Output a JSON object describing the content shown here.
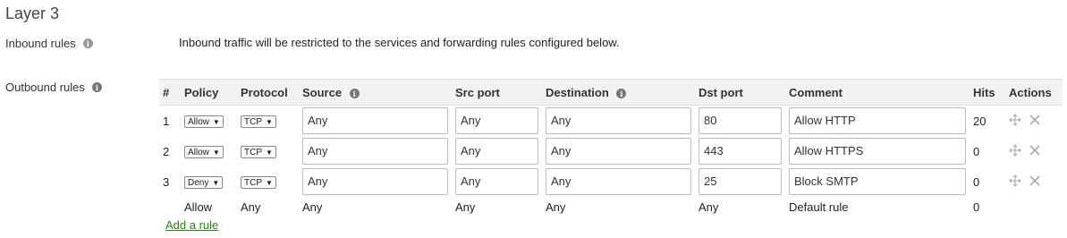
{
  "section_title": "Layer 3",
  "inbound": {
    "label": "Inbound rules",
    "info_icon": "info-icon",
    "text": "Inbound traffic will be restricted to the services and forwarding rules configured below."
  },
  "outbound": {
    "label": "Outbound rules",
    "info_icon": "info-icon",
    "headers": {
      "num": "#",
      "policy": "Policy",
      "protocol": "Protocol",
      "source": "Source",
      "src_port": "Src port",
      "destination": "Destination",
      "dst_port": "Dst port",
      "comment": "Comment",
      "hits": "Hits",
      "actions": "Actions"
    },
    "rules": [
      {
        "num": "1",
        "policy": "Allow",
        "protocol": "TCP",
        "source": "Any",
        "src_port": "Any",
        "destination": "Any",
        "dst_port": "80",
        "comment": "Allow HTTP",
        "hits": "20"
      },
      {
        "num": "2",
        "policy": "Allow",
        "protocol": "TCP",
        "source": "Any",
        "src_port": "Any",
        "destination": "Any",
        "dst_port": "443",
        "comment": "Allow HTTPS",
        "hits": "0"
      },
      {
        "num": "3",
        "policy": "Deny",
        "protocol": "TCP",
        "source": "Any",
        "src_port": "Any",
        "destination": "Any",
        "dst_port": "25",
        "comment": "Block SMTP",
        "hits": "0"
      }
    ],
    "default_rule": {
      "policy": "Allow",
      "protocol": "Any",
      "source": "Any",
      "src_port": "Any",
      "destination": "Any",
      "dst_port": "Any",
      "comment": "Default rule",
      "hits": "0"
    },
    "add_rule_label": "Add a rule"
  },
  "colors": {
    "link": "#2e7d1f",
    "header_bg": "#f2f2f2",
    "icon_gray": "#b0b0b0"
  }
}
